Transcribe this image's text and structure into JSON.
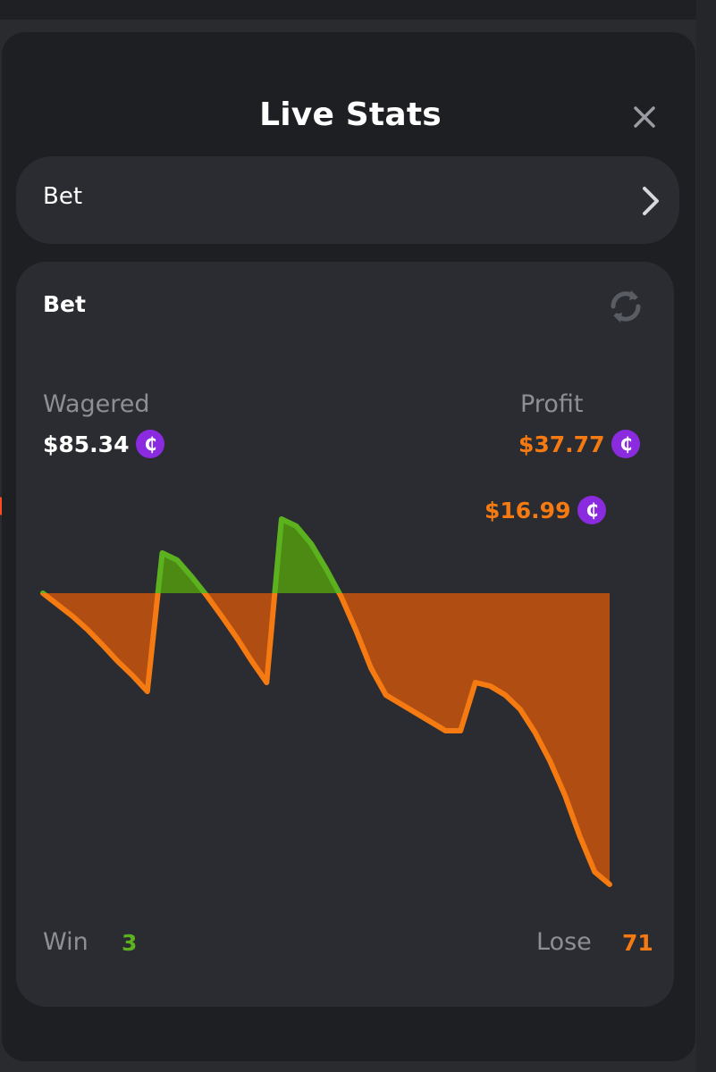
{
  "modal": {
    "title": "Live Stats",
    "close_icon": "close-icon"
  },
  "game_selector": {
    "label": "Bet",
    "chevron_icon": "chevron-right-icon"
  },
  "stats": {
    "title": "Bet",
    "refresh_icon": "refresh-icon",
    "wagered_label": "Wagered",
    "wagered_value": "$85.34",
    "profit_label": "Profit",
    "profit_value": "$37.77",
    "hover_value": "$16.99",
    "currency_icon": "coin-icon",
    "currency_glyph": "₵",
    "win_label": "Win",
    "win_count": "3",
    "lose_label": "Lose",
    "lose_count": "71"
  },
  "colors": {
    "background": "#1e1f22",
    "card": "#2b2c31",
    "win": "#5cb21e",
    "lose": "#f57a12",
    "coin": "#8b2be0",
    "muted": "#8d8f96"
  },
  "chart_data": {
    "type": "area",
    "series": [
      {
        "values": [
          0,
          -0.13,
          -0.26,
          -0.41,
          -0.58,
          -0.76,
          -0.92,
          -1.1,
          0.45,
          0.37,
          0.18,
          -0.03,
          -0.26,
          -0.5,
          -0.76,
          -1.0,
          0.83,
          0.75,
          0.55,
          0.27,
          -0.04,
          -0.42,
          -0.84,
          -1.14,
          -1.24,
          -1.34,
          -1.44,
          -1.54,
          -1.54,
          -1.0,
          -1.04,
          -1.14,
          -1.3,
          -1.56,
          -1.88,
          -2.26,
          -2.72,
          -3.12,
          -3.26
        ]
      }
    ],
    "baseline": 0,
    "positive_color": "#5cb21e",
    "negative_color": "#f57a12"
  }
}
